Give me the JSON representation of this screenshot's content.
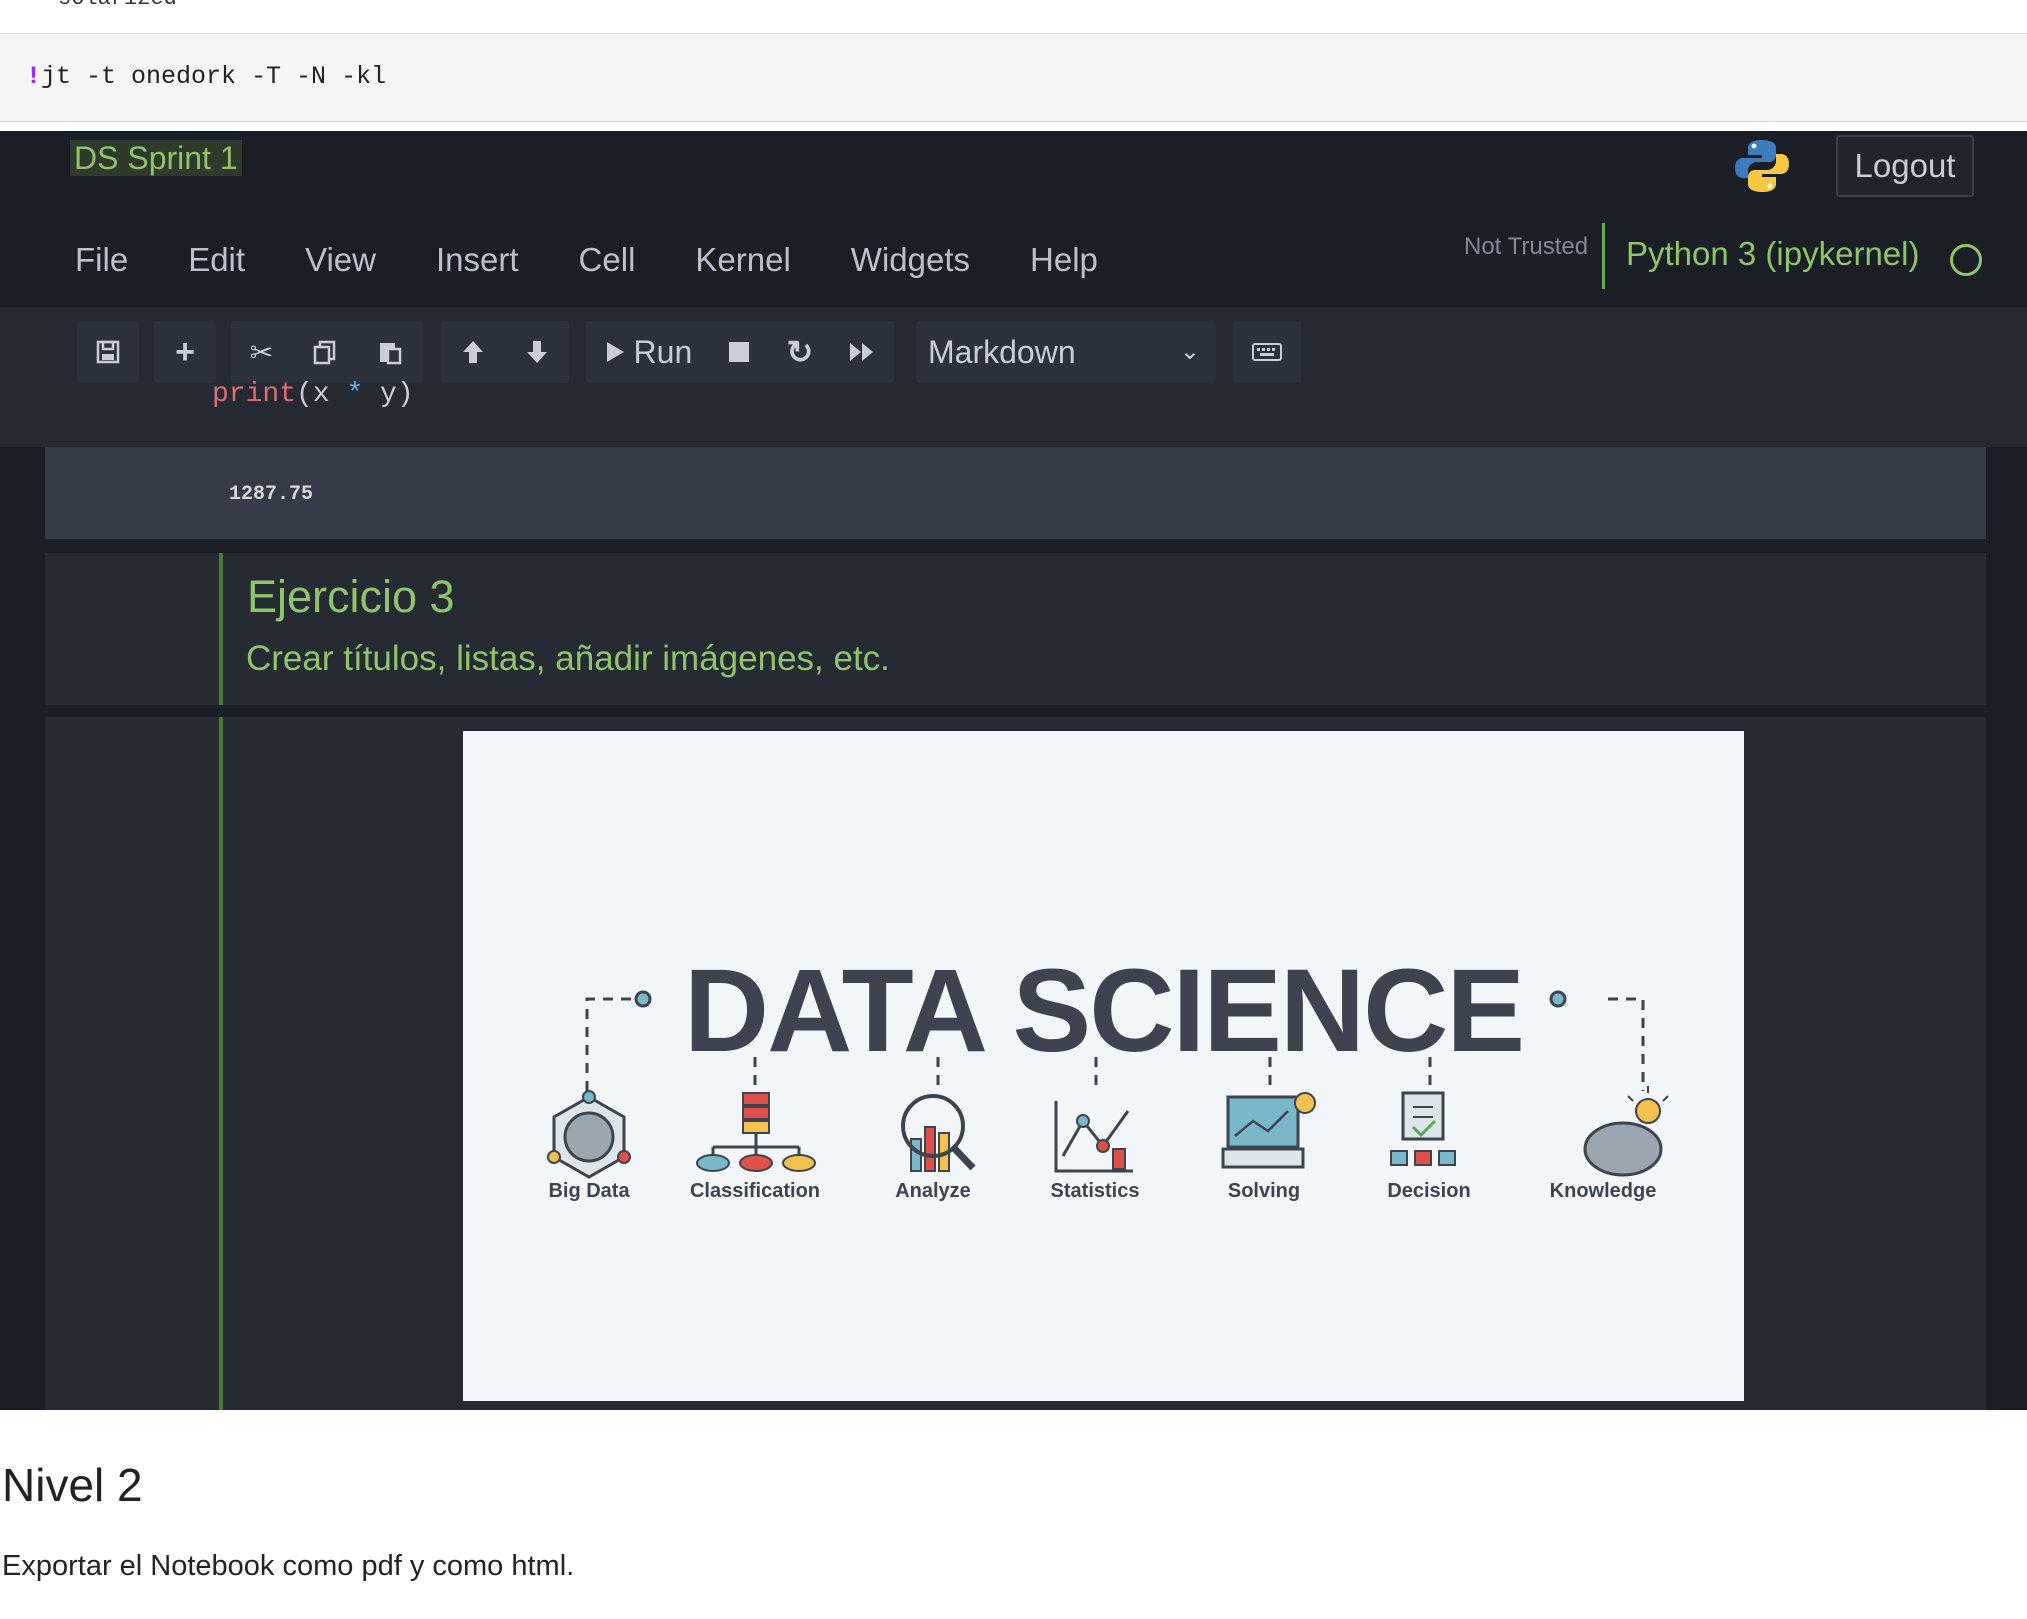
{
  "top_crop_text": "solarized",
  "top_code": {
    "bang": "!",
    "command": "jt -t onedork -T -N -kl"
  },
  "jupyter": {
    "notebook_title": "DS Sprint 1",
    "logout_label": "Logout",
    "menu": [
      "File",
      "Edit",
      "View",
      "Insert",
      "Cell",
      "Kernel",
      "Widgets",
      "Help"
    ],
    "trust_status": "Not Trusted",
    "kernel_name": "Python 3 (ipykernel)",
    "toolbar": {
      "run_label": "Run",
      "cell_type": "Markdown",
      "icons": [
        "save-icon",
        "plus-icon",
        "scissors-icon",
        "copy-icon",
        "paste-icon",
        "arrow-up-icon",
        "arrow-down-icon",
        "play-icon",
        "stop-icon",
        "restart-icon",
        "fast-forward-icon",
        "keyboard-icon"
      ]
    },
    "code_line": {
      "fn": "print",
      "open": "(x ",
      "op": "*",
      "close": " y)"
    },
    "output_value": "1287.75",
    "markdown_cell": {
      "heading": "Ejercicio 3",
      "paragraph": "Crear títulos, listas, añadir imágenes, etc."
    },
    "image": {
      "title": "DATA SCIENCE",
      "labels": [
        "Big Data",
        "Classification",
        "Analyze",
        "Statistics",
        "Solving",
        "Decision",
        "Knowledge"
      ]
    }
  },
  "nivel": {
    "heading": "Nivel 2",
    "paragraph": "Exportar el Notebook como pdf y como html."
  },
  "colors": {
    "accent_green": "#8fc46a",
    "dark_bg": "#1b1e24",
    "cell_bg": "#252a33"
  }
}
